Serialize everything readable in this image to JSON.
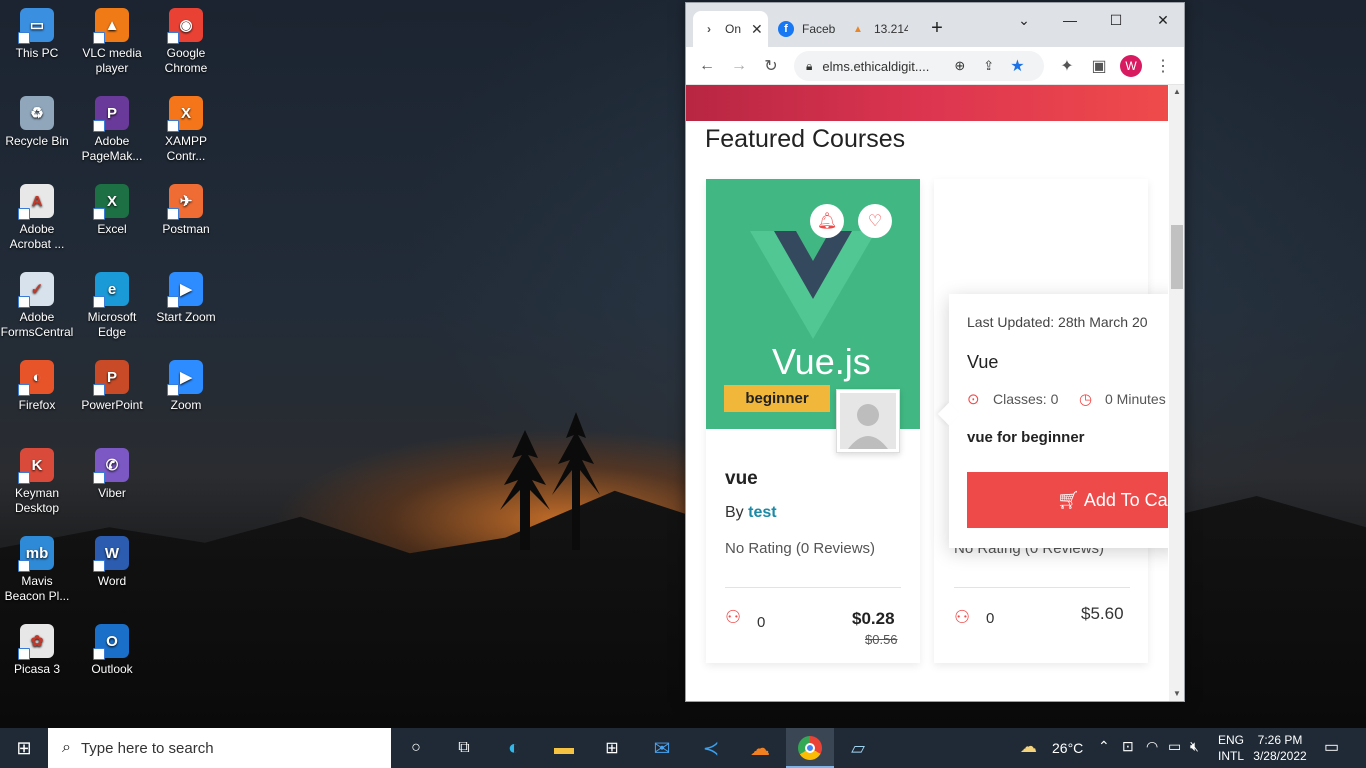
{
  "desktop": {
    "icons": [
      {
        "label": "This PC",
        "color": "#3a8fe0",
        "glyph": "▭"
      },
      {
        "label": "VLC media player",
        "color": "#f07a16",
        "glyph": "▲"
      },
      {
        "label": "Google Chrome",
        "color": "#e94235",
        "glyph": "◉"
      },
      {
        "label": "Recycle Bin",
        "color": "#8fa6bb",
        "glyph": "♻"
      },
      {
        "label": "Adobe PageMak...",
        "color": "#6a3a9a",
        "glyph": "P"
      },
      {
        "label": "XAMPP Contr...",
        "color": "#f5761a",
        "glyph": "X"
      },
      {
        "label": "Adobe Acrobat ...",
        "color": "#e8e8e8",
        "glyph": "A"
      },
      {
        "label": "Excel",
        "color": "#1d7044",
        "glyph": "X"
      },
      {
        "label": "Postman",
        "color": "#ef6c34",
        "glyph": "✈"
      },
      {
        "label": "Adobe FormsCentral",
        "color": "#d8e2ec",
        "glyph": "✓"
      },
      {
        "label": "Microsoft Edge",
        "color": "#1a9ad6",
        "glyph": "e"
      },
      {
        "label": "Start Zoom",
        "color": "#2d8cff",
        "glyph": "▶"
      },
      {
        "label": "Firefox",
        "color": "#e8542a",
        "glyph": "◐"
      },
      {
        "label": "PowerPoint",
        "color": "#c94a26",
        "glyph": "P"
      },
      {
        "label": "Zoom",
        "color": "#2d8cff",
        "glyph": "▶"
      },
      {
        "label": "Keyman Desktop",
        "color": "#d94a3a",
        "glyph": "K"
      },
      {
        "label": "Viber",
        "color": "#7b58c4",
        "glyph": "✆"
      },
      {
        "label": "Mavis Beacon Pl...",
        "color": "#2e8ad6",
        "glyph": "mb"
      },
      {
        "label": "Word",
        "color": "#2b5cb0",
        "glyph": "W"
      },
      {
        "label": "Picasa 3",
        "color": "#e7e7e7",
        "glyph": "✿"
      },
      {
        "label": "Outlook",
        "color": "#1a70c8",
        "glyph": "O"
      }
    ]
  },
  "browser": {
    "tabs": [
      {
        "title": "On",
        "favicon": "chevron-right-icon"
      },
      {
        "title": "Faceb",
        "favicon": "facebook-icon"
      },
      {
        "title": "13.214",
        "favicon": "pma-icon"
      }
    ],
    "new_tab_symbol": "+",
    "address": "elms.ethicaldigit....",
    "profile_initial": "W"
  },
  "page": {
    "section_title": "Featured Courses",
    "card1": {
      "thumbnail_text": "Vue.js",
      "level_badge": "beginner",
      "title": "vue",
      "by_label": "By",
      "author": "test",
      "rating": "No Rating (0 Reviews)",
      "students": "0",
      "price": "$0.28",
      "old_price": "$0.56"
    },
    "card2": {
      "rating": "No Rating (0 Reviews)",
      "students": "0",
      "price": "$5.60"
    },
    "popup": {
      "last_updated": "Last Updated: 28th March 20",
      "title": "Vue",
      "classes": "Classes: 0",
      "duration": "0 Minutes",
      "description": "vue for beginner",
      "add_to_cart": "Add To Ca"
    }
  },
  "taskbar": {
    "search_placeholder": "Type here to search",
    "weather": "26°C",
    "lang_top": "ENG",
    "lang_bottom": "INTL",
    "time": "7:26 PM",
    "date": "3/28/2022"
  }
}
